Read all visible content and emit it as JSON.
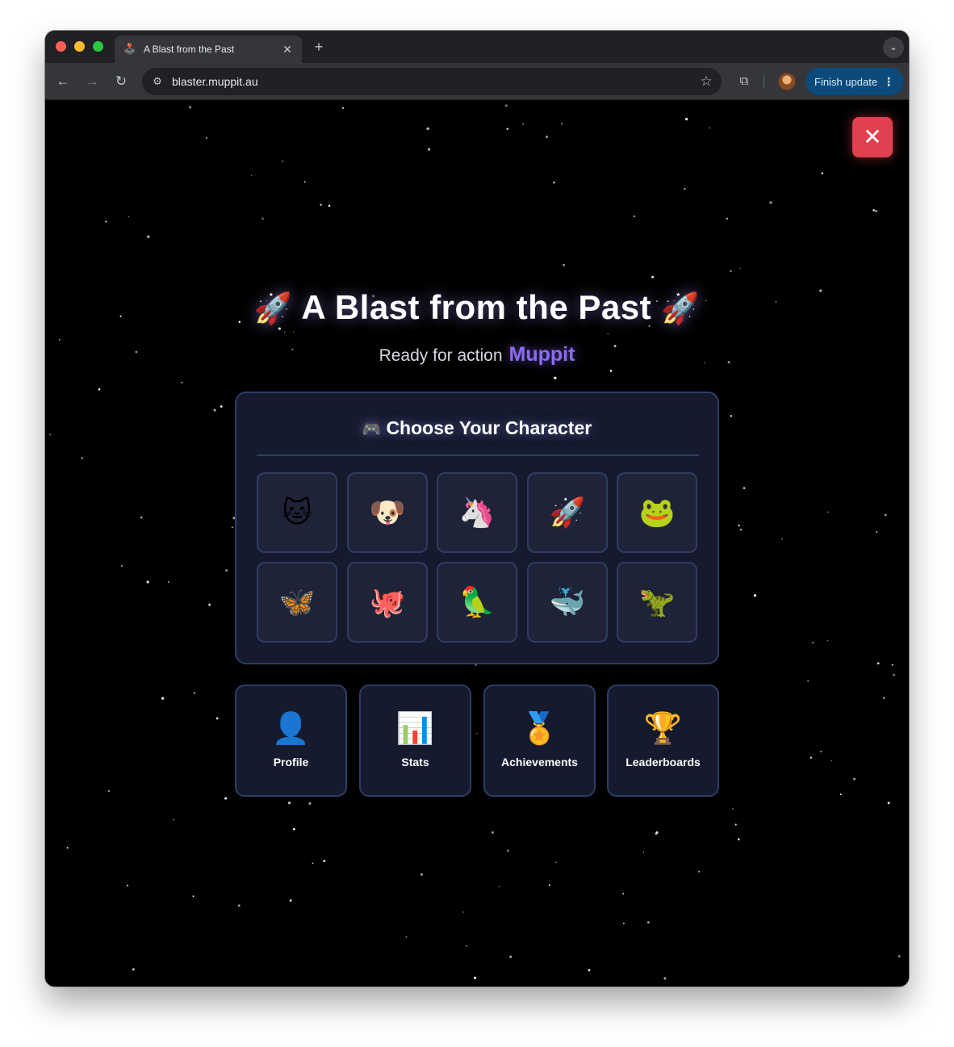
{
  "browser": {
    "tab_title": "A Blast from the Past",
    "tab_favicon": "🕹️",
    "url": "blaster.muppit.au",
    "finish_update_label": "Finish update",
    "icons": [
      "back-arrow-icon",
      "forward-arrow-icon",
      "reload-icon",
      "site-info-icon",
      "bookmark-star-icon",
      "extensions-puzzle-icon",
      "profile-avatar",
      "kebab-menu-icon",
      "tab-close-icon",
      "new-tab-plus-icon",
      "tab-search-chevron-icon"
    ]
  },
  "game": {
    "title": "A Blast from the Past",
    "title_emoji": "🚀",
    "subtitle_prefix": "Ready for action",
    "player_name": "Muppit",
    "close_symbol": "✕",
    "character_panel": {
      "title": "Choose Your Character",
      "title_emoji": "🎮",
      "characters": [
        "🐱",
        "🐶",
        "🦄",
        "🚀",
        "🐸",
        "🦋",
        "🐙",
        "🦜",
        "🐳",
        "🦖"
      ]
    },
    "menu": [
      {
        "label": "Profile",
        "icon": "👤"
      },
      {
        "label": "Stats",
        "icon": "📊"
      },
      {
        "label": "Achievements",
        "icon": "🏅"
      },
      {
        "label": "Leaderboards",
        "icon": "🏆"
      }
    ]
  },
  "colors": {
    "background": "#000000",
    "panel": "#161a2e",
    "panel_border": "#2c3d66",
    "close_button": "#e0404f",
    "player_name": "#8c6cf0",
    "finish_update": "#0b4a7a"
  }
}
